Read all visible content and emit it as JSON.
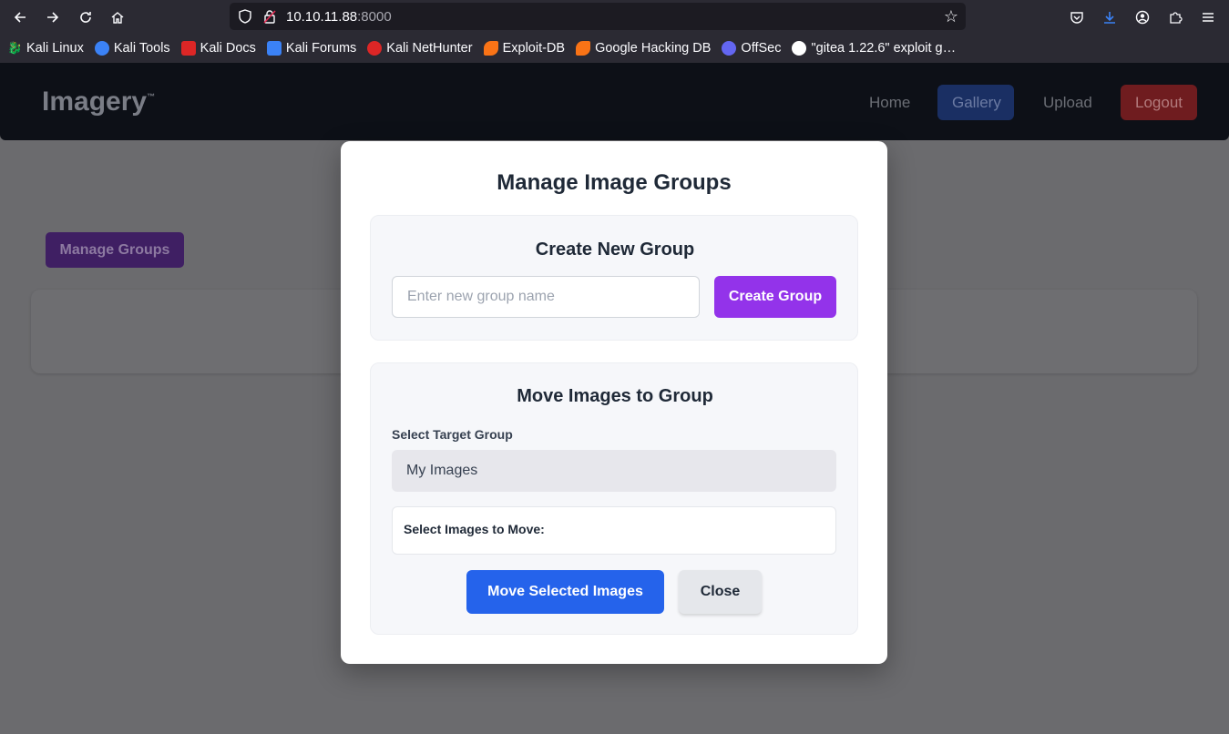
{
  "browser": {
    "url_host": "10.10.11.88",
    "url_port": ":8000",
    "bookmarks": [
      {
        "label": "Kali Linux",
        "color": "#2b2a33"
      },
      {
        "label": "Kali Tools",
        "color": "#3b82f6"
      },
      {
        "label": "Kali Docs",
        "color": "#dc2626"
      },
      {
        "label": "Kali Forums",
        "color": "#3b82f6"
      },
      {
        "label": "Kali NetHunter",
        "color": "#dc2626"
      },
      {
        "label": "Exploit-DB",
        "color": "#f97316"
      },
      {
        "label": "Google Hacking DB",
        "color": "#f97316"
      },
      {
        "label": "OffSec",
        "color": "#6366f1"
      },
      {
        "label": "\"gitea 1.22.6\" exploit g…",
        "color": "#ffffff"
      }
    ]
  },
  "site": {
    "logo": "Imagery",
    "logo_mark": "™",
    "nav": {
      "home": "Home",
      "gallery": "Gallery",
      "upload": "Upload",
      "logout": "Logout"
    },
    "manage_groups_label": "Manage Groups"
  },
  "modal": {
    "title": "Manage Image Groups",
    "create": {
      "title": "Create New Group",
      "placeholder": "Enter new group name",
      "button": "Create Group"
    },
    "move": {
      "title": "Move Images to Group",
      "select_label": "Select Target Group",
      "selected_group": "My Images",
      "images_label": "Select Images to Move:",
      "move_button": "Move Selected Images",
      "close_button": "Close"
    }
  }
}
